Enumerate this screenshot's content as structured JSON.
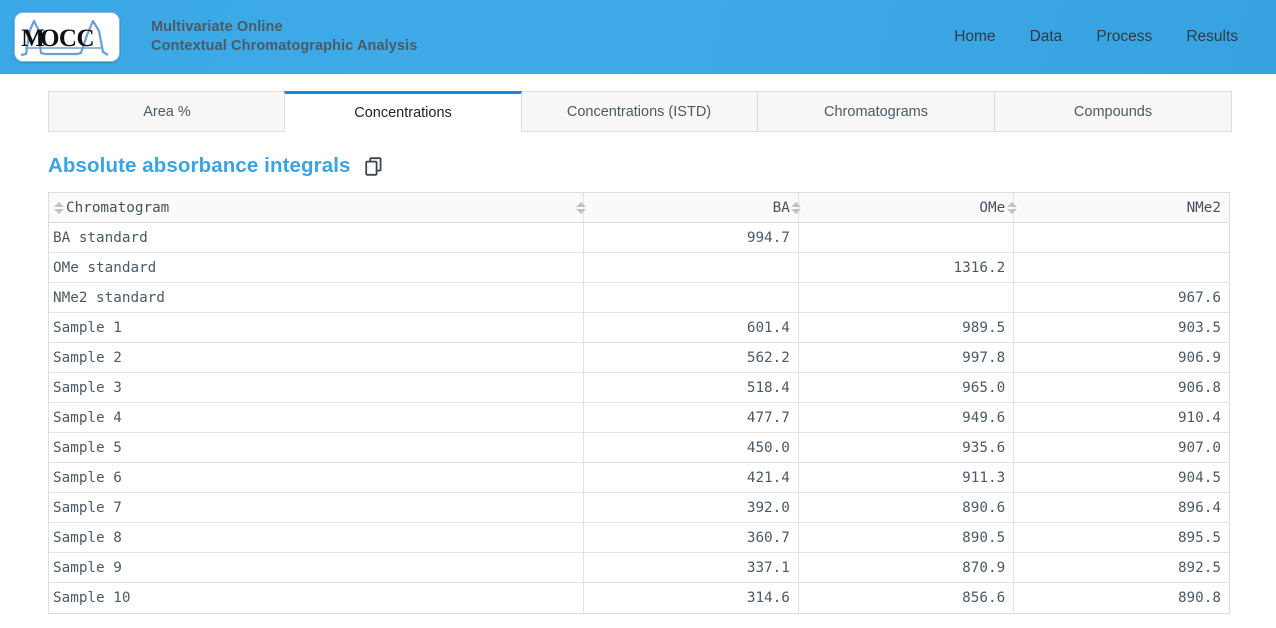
{
  "header": {
    "logo_text": "MOCCA",
    "logo_icon": "mocca-chromatogram-logo",
    "tagline_line1": "Multivariate Online",
    "tagline_line2": "Contextual Chromatographic Analysis",
    "accent_color": "#3aa8e6",
    "nav": [
      {
        "label": "Home"
      },
      {
        "label": "Data"
      },
      {
        "label": "Process"
      },
      {
        "label": "Results"
      }
    ]
  },
  "tabs": [
    {
      "label": "Area %",
      "active": false
    },
    {
      "label": "Concentrations",
      "active": true
    },
    {
      "label": "Concentrations (ISTD)",
      "active": false
    },
    {
      "label": "Chromatograms",
      "active": false
    },
    {
      "label": "Compounds",
      "active": false
    }
  ],
  "section": {
    "title": "Absolute absorbance integrals",
    "title_color": "#3aa3e3",
    "copy_icon": "copy-icon",
    "copy_label": "Copy table"
  },
  "table": {
    "columns": [
      {
        "label": "Chromatogram",
        "align": "left",
        "sortable": true
      },
      {
        "label": "BA",
        "align": "right",
        "sortable": true
      },
      {
        "label": "OMe",
        "align": "right",
        "sortable": true
      },
      {
        "label": "NMe2",
        "align": "right",
        "sortable": true
      }
    ],
    "rows": [
      {
        "name": "BA standard",
        "BA": "994.7",
        "OMe": "",
        "NMe2": ""
      },
      {
        "name": "OMe standard",
        "BA": "",
        "OMe": "1316.2",
        "NMe2": ""
      },
      {
        "name": "NMe2 standard",
        "BA": "",
        "OMe": "",
        "NMe2": "967.6"
      },
      {
        "name": "Sample 1",
        "BA": "601.4",
        "OMe": "989.5",
        "NMe2": "903.5"
      },
      {
        "name": "Sample 2",
        "BA": "562.2",
        "OMe": "997.8",
        "NMe2": "906.9"
      },
      {
        "name": "Sample 3",
        "BA": "518.4",
        "OMe": "965.0",
        "NMe2": "906.8"
      },
      {
        "name": "Sample 4",
        "BA": "477.7",
        "OMe": "949.6",
        "NMe2": "910.4"
      },
      {
        "name": "Sample 5",
        "BA": "450.0",
        "OMe": "935.6",
        "NMe2": "907.0"
      },
      {
        "name": "Sample 6",
        "BA": "421.4",
        "OMe": "911.3",
        "NMe2": "904.5"
      },
      {
        "name": "Sample 7",
        "BA": "392.0",
        "OMe": "890.6",
        "NMe2": "896.4"
      },
      {
        "name": "Sample 8",
        "BA": "360.7",
        "OMe": "890.5",
        "NMe2": "895.5"
      },
      {
        "name": "Sample 9",
        "BA": "337.1",
        "OMe": "870.9",
        "NMe2": "892.5"
      },
      {
        "name": "Sample 10",
        "BA": "314.6",
        "OMe": "856.6",
        "NMe2": "890.8"
      }
    ]
  }
}
